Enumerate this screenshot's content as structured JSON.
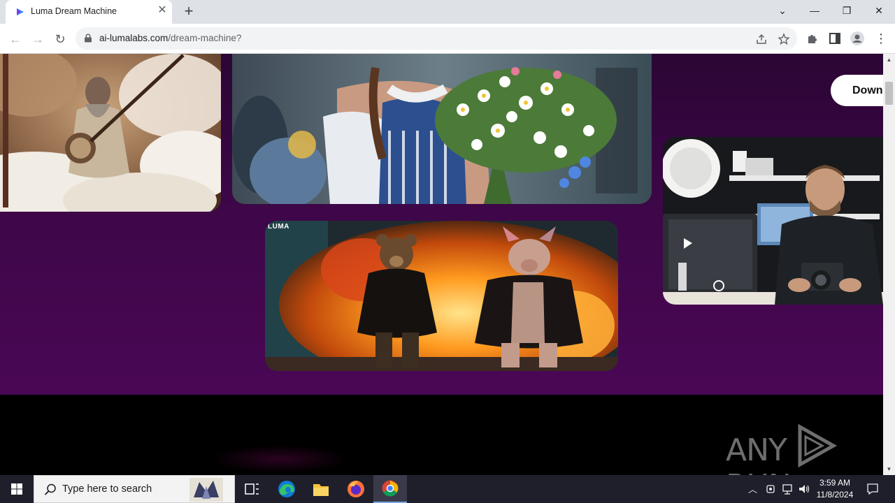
{
  "browser": {
    "tab_title": "Luma Dream Machine",
    "url_host": "ai-lumalabs.com",
    "url_path": "/dream-machine?"
  },
  "page": {
    "download_button_label": "Down",
    "card_watermark": "LUMA",
    "colors": {
      "page_purple": "#43064d",
      "footer_black": "#000000",
      "button_bg": "#ffffff"
    }
  },
  "watermark": {
    "text_left": "ANY",
    "text_right": "RUN"
  },
  "taskbar": {
    "search_placeholder": "Type here to search",
    "time": "3:59 AM",
    "date": "11/8/2024"
  }
}
